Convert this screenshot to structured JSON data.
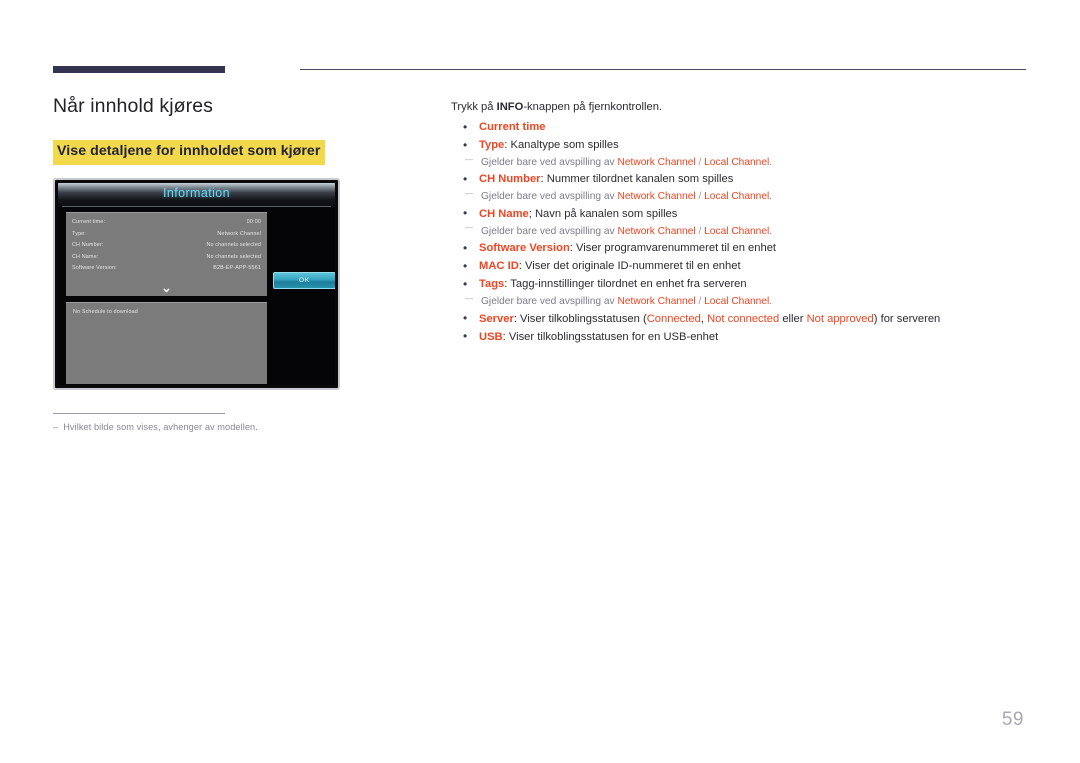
{
  "header": {
    "accent_color": "#343450",
    "rule_color": "#4a4a5e"
  },
  "left": {
    "page_title": "Når innhold kjøres",
    "section_title": "Vise detaljene for innholdet som kjører",
    "highlight_color": "#f2d84b",
    "footnote_dash": "–",
    "footnote_text": "Hvilket bilde som vises, avhenger av modellen."
  },
  "tv": {
    "title": "Information",
    "title_color": "#6fd8f2",
    "rows": [
      {
        "key": "Current time:",
        "value": "00:00"
      },
      {
        "key": "Type:",
        "value": "Network Channel"
      },
      {
        "key": "CH Number:",
        "value": "No channels selected"
      },
      {
        "key": "CH Name:",
        "value": "No channels selected"
      },
      {
        "key": "Software Version:",
        "value": "B2B-EP-APP-5561"
      }
    ],
    "chevron": "⌄",
    "schedule_message": "No Schedule to download",
    "ok_label": "OK"
  },
  "right": {
    "accent_color": "#ef4523",
    "intro_before": "Trykk på ",
    "intro_bold": "INFO",
    "intro_after": "-knappen på fjernkontrollen.",
    "note_prefix": "Gjelder bare ved avspilling av ",
    "note_channel_a": "Network Channel",
    "note_sep": " / ",
    "note_channel_b": "Local Channel",
    "note_suffix": ".",
    "items": {
      "current_time_term": "Current time",
      "type_term": "Type",
      "type_desc": ": Kanaltype som spilles",
      "ch_number_term": "CH Number",
      "ch_number_desc": ": Nummer tilordnet kanalen som spilles",
      "ch_name_term": "CH Name",
      "ch_name_desc": "; Navn på kanalen som spilles",
      "software_version_term": "Software Version",
      "software_version_desc": ": Viser programvarenummeret til en enhet",
      "mac_id_term": "MAC ID",
      "mac_id_desc": ": Viser det originale ID-nummeret til en enhet",
      "tags_term": "Tags",
      "tags_desc": ": Tagg-innstillinger tilordnet en enhet fra serveren",
      "server_term": "Server",
      "server_desc_1": ": Viser tilkoblingsstatusen (",
      "server_status_1": "Connected",
      "server_desc_2": ", ",
      "server_status_2": "Not connected",
      "server_desc_3": " eller ",
      "server_status_3": "Not approved",
      "server_desc_4": ") for serveren",
      "usb_term": "USB",
      "usb_desc": ": Viser tilkoblingsstatusen for en USB-enhet"
    }
  },
  "page_number": "59"
}
